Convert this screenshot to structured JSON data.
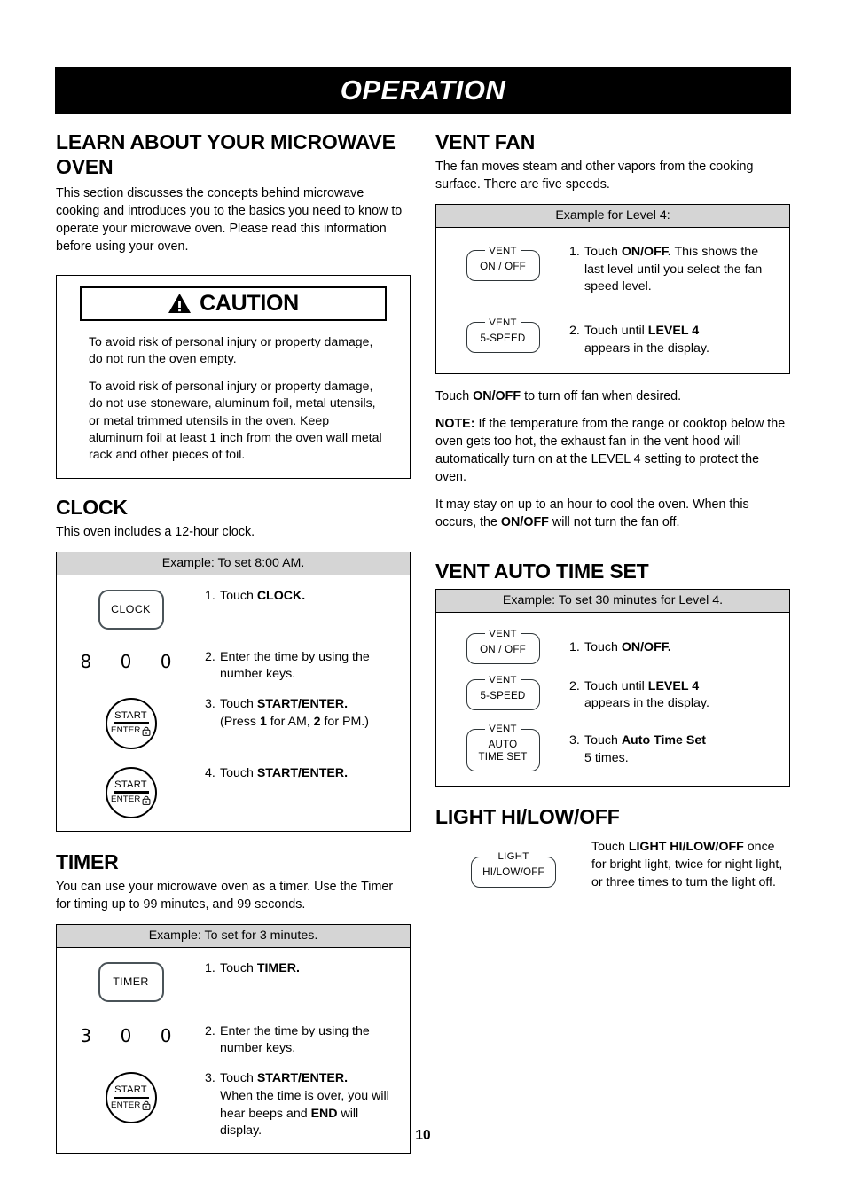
{
  "header": {
    "title": "OPERATION"
  },
  "page_number": "10",
  "left_column": {
    "learn_heading": "LEARN ABOUT YOUR MICROWAVE OVEN",
    "learn_body": "This section discusses the concepts behind microwave cooking and introduces you to the basics you need to know to operate your microwave oven. Please read this information before using your oven.",
    "caution": {
      "label": "CAUTION",
      "icon": "warning-triangle-icon",
      "paragraph_1": "To avoid risk of personal injury or property damage, do not run the oven empty.",
      "paragraph_2": "To avoid risk of personal injury or property damage, do not use stoneware, aluminum foil, metal utensils, or metal trimmed utensils in the oven. Keep aluminum foil at least 1 inch from the oven wall metal rack and other pieces of foil."
    },
    "clock": {
      "heading": "CLOCK",
      "intro": "This oven includes a 12-hour clock.",
      "example_header": "Example: To set 8:00 AM.",
      "steps": [
        {
          "key": "CLOCK",
          "key_type": "rounded",
          "number": "1.",
          "text_before": "Touch ",
          "text_bold": "CLOCK.",
          "text_after": ""
        },
        {
          "key": "8 0 0",
          "key_type": "digits",
          "number": "2.",
          "text_before": "Enter the time by using the number keys.",
          "text_bold": "",
          "text_after": ""
        },
        {
          "key": "START/ENTER",
          "key_type": "circle",
          "number": "3.",
          "text_before": "Touch ",
          "text_bold": "START/ENTER.",
          "text_after": " (Press 1 for AM, 2 for PM.)"
        },
        {
          "key": "START/ENTER",
          "key_type": "circle",
          "number": "4.",
          "text_before": "Touch ",
          "text_bold": "START/ENTER.",
          "text_after": ""
        }
      ]
    },
    "timer": {
      "heading": "TIMER",
      "intro": "You can use your microwave oven as a timer. Use the Timer for timing up to 99 minutes, and 99 seconds.",
      "example_header": "Example: To set for 3 minutes.",
      "steps": [
        {
          "key": "TIMER",
          "key_type": "rounded",
          "number": "1.",
          "text_before": "Touch  ",
          "text_bold": "TIMER.",
          "text_after": ""
        },
        {
          "key": "3 0 0",
          "key_type": "digits",
          "number": "2.",
          "text_before": "Enter the time by using the number keys.",
          "text_bold": "",
          "text_after": ""
        },
        {
          "key": "START/ENTER",
          "key_type": "circle",
          "number": "3.",
          "text_before": "Touch ",
          "text_bold": "START/ENTER.",
          "text_after": " When the time is over, you will hear beeps and END will display."
        }
      ]
    }
  },
  "right_column": {
    "vent_fan": {
      "heading": "VENT FAN",
      "intro": "The fan moves steam and other vapors from the cooking surface. There are five speeds.",
      "example_header": "Example for Level 4:",
      "steps": [
        {
          "key_legend": "VENT",
          "key_label": "ON / OFF",
          "number": "1.",
          "text_before": "Touch ",
          "text_bold": "ON/OFF.",
          "text_after": " This shows the last level until you select the fan speed level."
        },
        {
          "key_legend": "VENT",
          "key_label": "5-SPEED",
          "number": "2.",
          "text_before": "Touch until ",
          "text_bold": "LEVEL 4",
          "text_after": " appears in the display."
        }
      ],
      "note_1_before": "Touch ",
      "note_1_bold": "ON/OFF",
      "note_1_after": " to turn off fan when desired.",
      "note_2_bold": "NOTE:",
      "note_2_text": " If the temperature from the range or cooktop below the oven gets too hot, the exhaust fan in the vent hood will automatically turn on at the LEVEL 4 setting to protect the oven.",
      "note_3_before": "It may stay on up to an hour to cool the oven. When this occurs, the ",
      "note_3_bold": "ON/OFF",
      "note_3_after": " will not turn the fan off."
    },
    "vent_auto_time_set": {
      "heading": "VENT AUTO TIME SET",
      "example_header": "Example: To set 30 minutes for Level 4.",
      "steps": [
        {
          "key_legend": "VENT",
          "key_label": "ON / OFF",
          "number": "1.",
          "text_before": "Touch ",
          "text_bold": "ON/OFF.",
          "text_after": ""
        },
        {
          "key_legend": "VENT",
          "key_label": "5-SPEED",
          "number": "2.",
          "text_before": "Touch until ",
          "text_bold": "LEVEL 4",
          "text_after": " appears in the display."
        },
        {
          "key_legend": "VENT",
          "key_label": "AUTO TIME SET",
          "number": "3.",
          "text_before": "Touch ",
          "text_bold": "Auto Time Set",
          "text_after": " 5 times."
        }
      ]
    },
    "light": {
      "heading": "LIGHT HI/LOW/OFF",
      "key_legend": "LIGHT",
      "key_label": "HI/LOW/OFF",
      "text_before": "Touch ",
      "text_bold": "LIGHT HI/LOW/OFF",
      "text_after": " once for bright light, twice for night light, or three times to turn the light off."
    }
  },
  "colors": {
    "banner_bg": "#000000",
    "banner_text": "#ffffff",
    "table_header_bg": "#d5d5d5",
    "key_border": "#4a5358"
  }
}
